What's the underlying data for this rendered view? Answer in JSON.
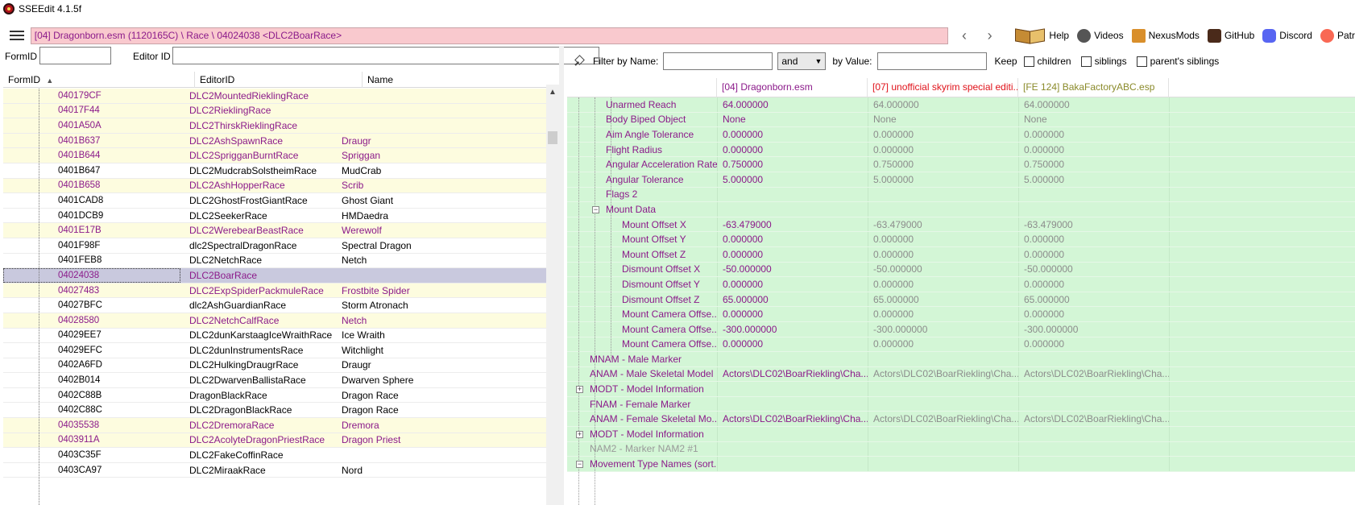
{
  "window": {
    "title": "SSEEdit 4.1.5f"
  },
  "toolbar": {
    "path": "[04] Dragonborn.esm (1120165C) \\ Race \\ 04024038 <DLC2BoarRace>",
    "back_arrow": "‹",
    "forward_arrow": "›",
    "links": [
      {
        "label": "Help",
        "icon": "book-icon",
        "color": "#c58b34"
      },
      {
        "label": "Videos",
        "icon": "videos-icon",
        "color": "#555555"
      },
      {
        "label": "NexusMods",
        "icon": "nexusmods-icon",
        "color": "#d98f2b"
      },
      {
        "label": "GitHub",
        "icon": "github-icon",
        "color": "#4a2a1a"
      },
      {
        "label": "Discord",
        "icon": "discord-icon",
        "color": "#5865f2"
      },
      {
        "label": "Patr",
        "icon": "patreon-icon",
        "color": "#f96854"
      }
    ]
  },
  "left_filter": {
    "formid_label": "FormID",
    "editorid_label": "Editor ID",
    "formid_value": "",
    "editorid_value": ""
  },
  "grid": {
    "headers": [
      "FormID",
      "EditorID",
      "Name"
    ],
    "sort_indicator": "▲",
    "rows": [
      {
        "formid": "040179CF",
        "editorid": "DLC2MountedRieklingRace",
        "name": "",
        "style": "yellow magenta"
      },
      {
        "formid": "04017F44",
        "editorid": "DLC2RieklingRace",
        "name": "",
        "style": "yellow magenta"
      },
      {
        "formid": "0401A50A",
        "editorid": "DLC2ThirskRieklingRace",
        "name": "",
        "style": "yellow magenta"
      },
      {
        "formid": "0401B637",
        "editorid": "DLC2AshSpawnRace",
        "name": "Draugr",
        "style": "yellow magenta"
      },
      {
        "formid": "0401B644",
        "editorid": "DLC2SprigganBurntRace",
        "name": "Spriggan",
        "style": "yellow magenta"
      },
      {
        "formid": "0401B647",
        "editorid": "DLC2MudcrabSolstheimRace",
        "name": "MudCrab",
        "style": ""
      },
      {
        "formid": "0401B658",
        "editorid": "DLC2AshHopperRace",
        "name": "Scrib",
        "style": "yellow magenta"
      },
      {
        "formid": "0401CAD8",
        "editorid": "DLC2GhostFrostGiantRace",
        "name": "Ghost Giant",
        "style": ""
      },
      {
        "formid": "0401DCB9",
        "editorid": "DLC2SeekerRace",
        "name": "HMDaedra",
        "style": ""
      },
      {
        "formid": "0401E17B",
        "editorid": "DLC2WerebearBeastRace",
        "name": "Werewolf",
        "style": "yellow magenta"
      },
      {
        "formid": "0401F98F",
        "editorid": "dlc2SpectralDragonRace",
        "name": "Spectral Dragon",
        "style": ""
      },
      {
        "formid": "0401FEB8",
        "editorid": "DLC2NetchRace",
        "name": "Netch",
        "style": ""
      },
      {
        "formid": "04024038",
        "editorid": "DLC2BoarRace",
        "name": "",
        "style": "selected magenta"
      },
      {
        "formid": "04027483",
        "editorid": "DLC2ExpSpiderPackmuleRace",
        "name": "Frostbite Spider",
        "style": "yellow magenta"
      },
      {
        "formid": "04027BFC",
        "editorid": "dlc2AshGuardianRace",
        "name": "Storm Atronach",
        "style": ""
      },
      {
        "formid": "04028580",
        "editorid": "DLC2NetchCalfRace",
        "name": "Netch",
        "style": "yellow magenta"
      },
      {
        "formid": "04029EE7",
        "editorid": "DLC2dunKarstaagIceWraithRace",
        "name": "Ice Wraith",
        "style": ""
      },
      {
        "formid": "04029EFC",
        "editorid": "DLC2dunInstrumentsRace",
        "name": "Witchlight",
        "style": ""
      },
      {
        "formid": "0402A6FD",
        "editorid": "DLC2HulkingDraugrRace",
        "name": "Draugr",
        "style": ""
      },
      {
        "formid": "0402B014",
        "editorid": "DLC2DwarvenBallistaRace",
        "name": "Dwarven Sphere",
        "style": ""
      },
      {
        "formid": "0402C88B",
        "editorid": "DragonBlackRace",
        "name": "Dragon Race",
        "style": ""
      },
      {
        "formid": "0402C88C",
        "editorid": "DLC2DragonBlackRace",
        "name": "Dragon Race",
        "style": ""
      },
      {
        "formid": "04035538",
        "editorid": "DLC2DremoraRace",
        "name": "Dremora",
        "style": "yellow magenta"
      },
      {
        "formid": "0403911A",
        "editorid": "DLC2AcolyteDragonPriestRace",
        "name": "Dragon Priest",
        "style": "yellow magenta"
      },
      {
        "formid": "0403C35F",
        "editorid": "DLC2FakeCoffinRace",
        "name": "",
        "style": ""
      },
      {
        "formid": "0403CA97",
        "editorid": "DLC2MiraakRace",
        "name": "Nord",
        "style": ""
      }
    ]
  },
  "right_filter": {
    "filter_by_name_label": "Filter by Name:",
    "operator": "and",
    "by_value_label": "by Value:",
    "keep_label": "Keep",
    "children_label": "children",
    "siblings_label": "siblings",
    "parents_siblings_label": "parent's siblings"
  },
  "record_view": {
    "headers": [
      "[04] Dragonborn.esm",
      "[07] unofficial skyrim special editi...",
      "[FE 124] BakaFactoryABC.esp"
    ],
    "header_colors": [
      "#8b1a8a",
      "#e0121a",
      "#8a8a2a"
    ],
    "rows": [
      {
        "label": "Unarmed Reach",
        "indent": 2,
        "v1": "64.000000",
        "v2": "64.000000",
        "v3": "64.000000"
      },
      {
        "label": "Body Biped Object",
        "indent": 2,
        "v1": "None",
        "v2": "None",
        "v3": "None"
      },
      {
        "label": "Aim Angle Tolerance",
        "indent": 2,
        "v1": "0.000000",
        "v2": "0.000000",
        "v3": "0.000000"
      },
      {
        "label": "Flight Radius",
        "indent": 2,
        "v1": "0.000000",
        "v2": "0.000000",
        "v3": "0.000000"
      },
      {
        "label": "Angular Acceleration Rate",
        "indent": 2,
        "v1": "0.750000",
        "v2": "0.750000",
        "v3": "0.750000"
      },
      {
        "label": "Angular Tolerance",
        "indent": 2,
        "v1": "5.000000",
        "v2": "5.000000",
        "v3": "5.000000"
      },
      {
        "label": "Flags 2",
        "indent": 2,
        "v1": "",
        "v2": "",
        "v3": ""
      },
      {
        "label": "Mount Data",
        "indent": 2,
        "expander": "−",
        "v1": "",
        "v2": "",
        "v3": ""
      },
      {
        "label": "Mount Offset X",
        "indent": 3,
        "v1": "-63.479000",
        "v2": "-63.479000",
        "v3": "-63.479000"
      },
      {
        "label": "Mount Offset Y",
        "indent": 3,
        "v1": "0.000000",
        "v2": "0.000000",
        "v3": "0.000000"
      },
      {
        "label": "Mount Offset Z",
        "indent": 3,
        "v1": "0.000000",
        "v2": "0.000000",
        "v3": "0.000000"
      },
      {
        "label": "Dismount Offset X",
        "indent": 3,
        "v1": "-50.000000",
        "v2": "-50.000000",
        "v3": "-50.000000"
      },
      {
        "label": "Dismount Offset Y",
        "indent": 3,
        "v1": "0.000000",
        "v2": "0.000000",
        "v3": "0.000000"
      },
      {
        "label": "Dismount Offset Z",
        "indent": 3,
        "v1": "65.000000",
        "v2": "65.000000",
        "v3": "65.000000"
      },
      {
        "label": "Mount Camera Offse...",
        "indent": 3,
        "v1": "0.000000",
        "v2": "0.000000",
        "v3": "0.000000"
      },
      {
        "label": "Mount Camera Offse...",
        "indent": 3,
        "v1": "-300.000000",
        "v2": "-300.000000",
        "v3": "-300.000000"
      },
      {
        "label": "Mount Camera Offse...",
        "indent": 3,
        "v1": "0.000000",
        "v2": "0.000000",
        "v3": "0.000000"
      },
      {
        "label": "MNAM - Male Marker",
        "indent": 1,
        "v1": "",
        "v2": "",
        "v3": ""
      },
      {
        "label": "ANAM - Male Skeletal Model",
        "indent": 1,
        "v1": "Actors\\DLC02\\BoarRiekling\\Cha...",
        "v2": "Actors\\DLC02\\BoarRiekling\\Cha...",
        "v3": "Actors\\DLC02\\BoarRiekling\\Cha..."
      },
      {
        "label": "MODT - Model Information",
        "indent": 1,
        "expander": "+",
        "v1": "",
        "v2": "",
        "v3": ""
      },
      {
        "label": "FNAM - Female Marker",
        "indent": 1,
        "v1": "",
        "v2": "",
        "v3": ""
      },
      {
        "label": "ANAM - Female Skeletal Mo...",
        "indent": 1,
        "v1": "Actors\\DLC02\\BoarRiekling\\Cha...",
        "v2": "Actors\\DLC02\\BoarRiekling\\Cha...",
        "v3": "Actors\\DLC02\\BoarRiekling\\Cha..."
      },
      {
        "label": "MODT - Model Information",
        "indent": 1,
        "expander": "+",
        "v1": "",
        "v2": "",
        "v3": ""
      },
      {
        "label": "NAM2 - Marker NAM2 #1",
        "indent": 1,
        "gray": true,
        "v1": "",
        "v2": "",
        "v3": ""
      },
      {
        "label": "Movement Type Names (sort...",
        "indent": 1,
        "expander": "−",
        "v1": "",
        "v2": "",
        "v3": ""
      }
    ]
  }
}
